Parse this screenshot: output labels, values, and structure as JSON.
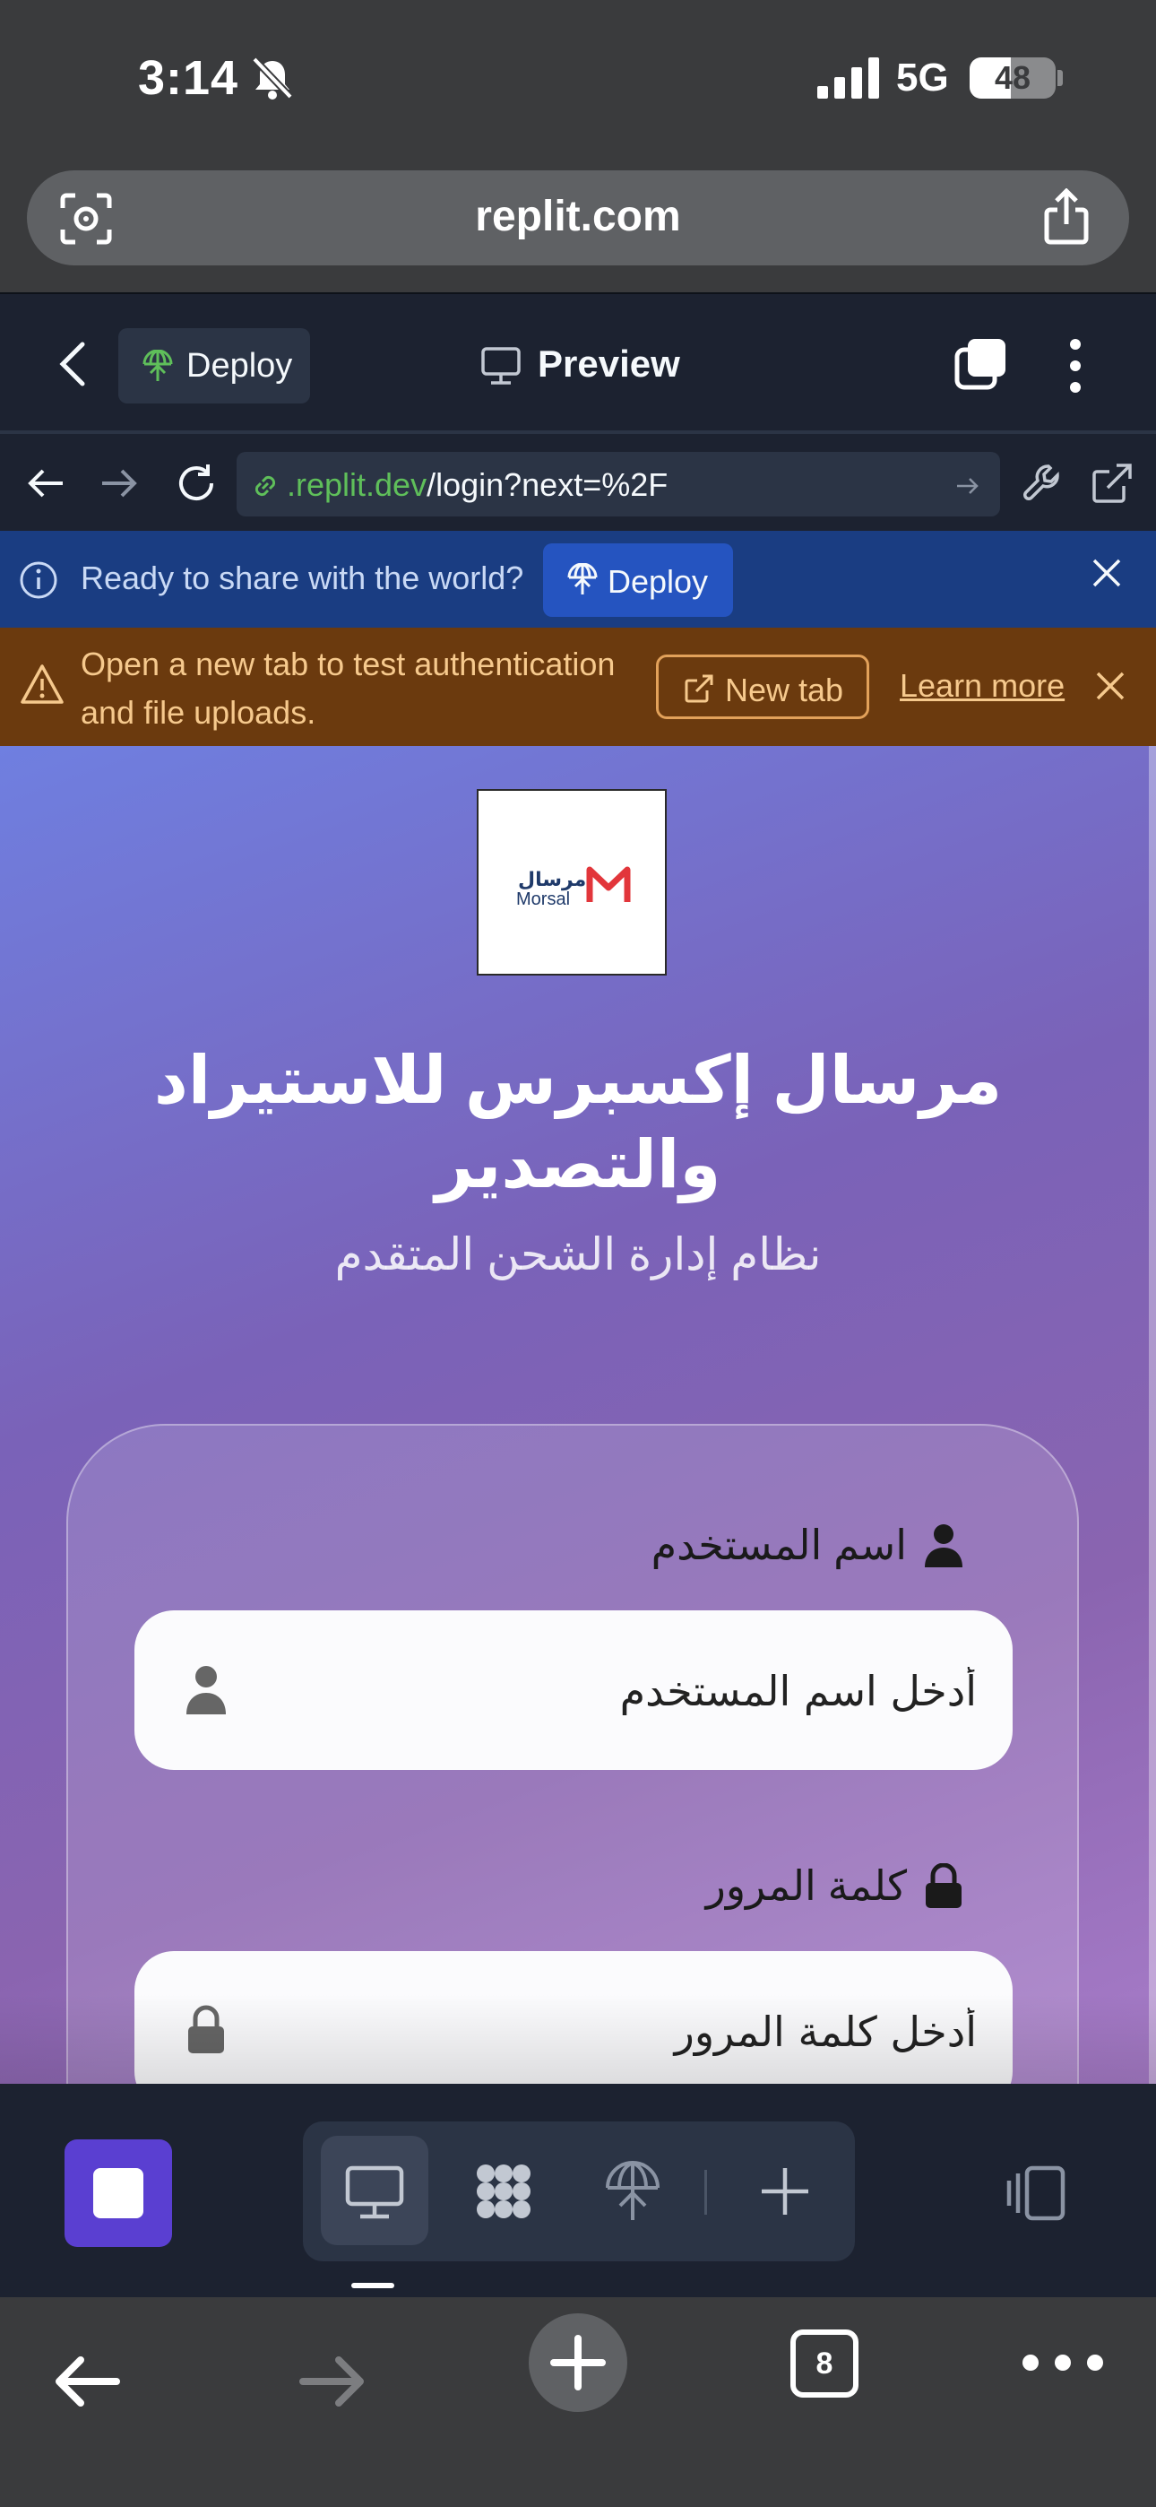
{
  "status_bar": {
    "time": "3:14",
    "network": "5G",
    "battery": "48",
    "battery_level": 0.48
  },
  "safari": {
    "url": "replit.com",
    "tab_count": "8"
  },
  "replit_header": {
    "deploy_label": "Deploy",
    "preview_label": "Preview"
  },
  "webview": {
    "url_domain": ".replit.dev",
    "url_path": "/login?next=%2F"
  },
  "deploy_banner": {
    "message": "Ready to share with the world?",
    "button_label": "Deploy"
  },
  "auth_banner": {
    "message": "Open a new tab to test authentication and file uploads.",
    "new_tab_label": "New tab",
    "learn_more_label": "Learn more"
  },
  "login_page": {
    "logo_arabic": "مرسال",
    "logo_english": "Morsal",
    "title": "مرسال إكسبرس للاستيراد والتصدير",
    "subtitle": "نظام إدارة الشحن المتقدم",
    "username": {
      "label": "اسم المستخدم",
      "placeholder": "أدخل اسم المستخدم"
    },
    "password": {
      "label": "كلمة المرور",
      "placeholder": "أدخل كلمة المرور"
    }
  },
  "colors": {
    "brand_red": "#e2363b",
    "replit_dark": "#1c2230",
    "deploy_blue": "#2554c0",
    "warning": "#6b3a0e"
  },
  "icons": [
    "bell-slash-icon",
    "signal-icon",
    "lens-icon",
    "share-icon",
    "chevron-left-icon",
    "deploy-icon",
    "monitor-icon",
    "tabs-icon",
    "kebab-icon",
    "arrow-left-icon",
    "arrow-right-icon",
    "reload-icon",
    "link-icon",
    "wrench-icon",
    "external-link-icon",
    "info-icon",
    "close-icon",
    "warning-icon",
    "user-icon",
    "lock-icon",
    "plus-icon",
    "panel-icon",
    "dots-icon"
  ]
}
